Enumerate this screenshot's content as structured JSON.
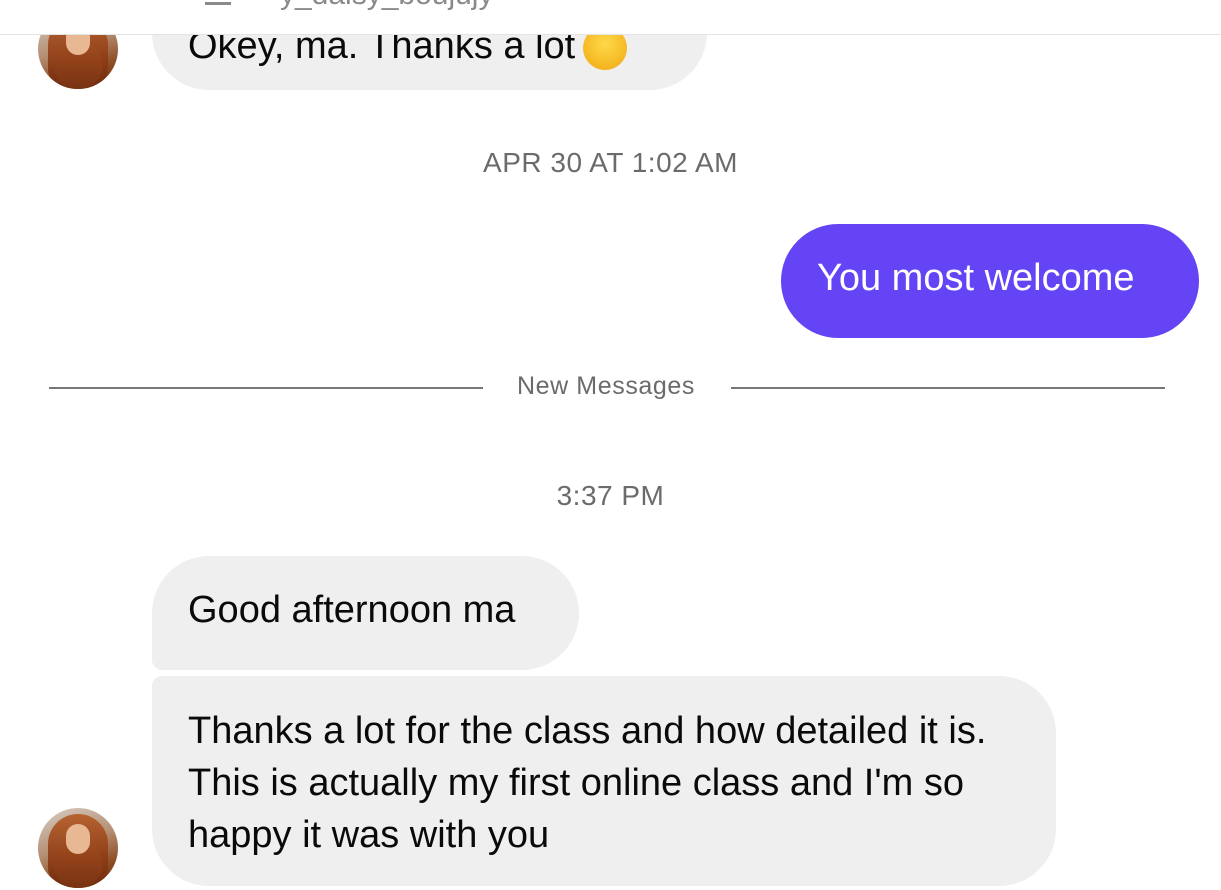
{
  "header": {
    "title": "y_daisy_boujujy"
  },
  "messages": {
    "m1": {
      "text": "Okey, ma. Thanks a lot",
      "emoji": "smiling-face-emoji"
    },
    "ts1": "APR 30 AT 1:02 AM",
    "m2": {
      "text": "You most welcome"
    },
    "divider": "New Messages",
    "ts2": "3:37 PM",
    "m3": {
      "text": "Good afternoon ma"
    },
    "m4": {
      "text": "Thanks a lot for the class and how detailed it is. This is actually my first online class and I'm so happy it was with you"
    }
  },
  "colors": {
    "outgoing_bubble": "#6544f5",
    "incoming_bubble": "#efefef",
    "timestamp_text": "#6b6b6b"
  }
}
